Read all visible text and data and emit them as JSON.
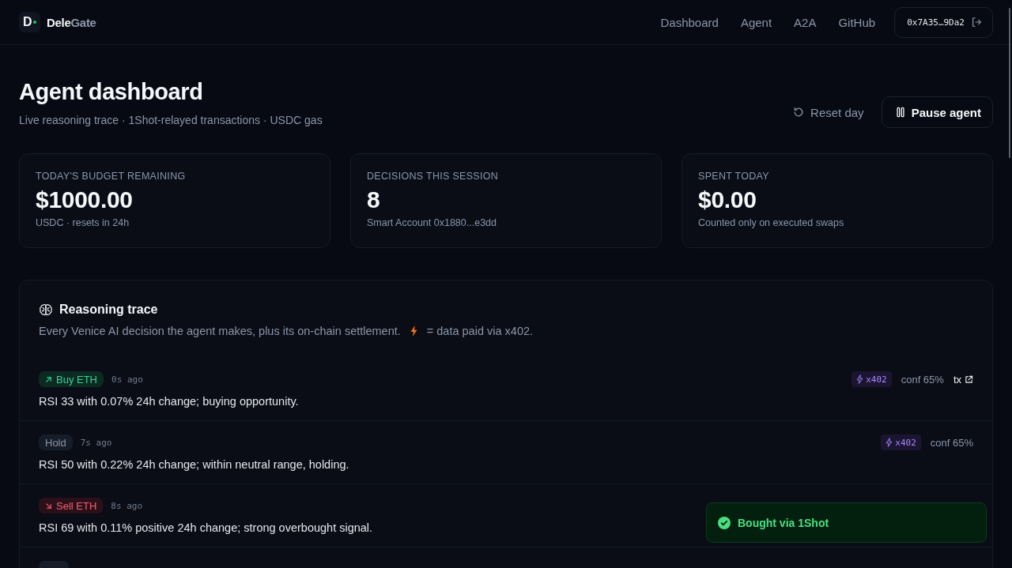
{
  "header": {
    "logo_mark": "D",
    "brand_parts": [
      {
        "text": "Dele",
        "kind": "strong"
      },
      {
        "text": "Gate",
        "kind": "muted"
      }
    ],
    "nav": [
      {
        "label": "Dashboard"
      },
      {
        "label": "Agent"
      },
      {
        "label": "A2A"
      },
      {
        "label": "GitHub"
      }
    ],
    "wallet": {
      "address": "0x7A35…9Da2"
    }
  },
  "page": {
    "title": "Agent dashboard",
    "subtitle": "Live reasoning trace · 1Shot-relayed transactions · USDC gas",
    "actions": [
      {
        "label": "Reset day",
        "kind": "ghost"
      },
      {
        "label": "Pause agent",
        "kind": "outline"
      }
    ]
  },
  "stats": [
    {
      "label": "TODAY'S BUDGET REMAINING",
      "value": "$1000.00",
      "note": "USDC · resets in 24h"
    },
    {
      "label": "DECISIONS THIS SESSION",
      "value": "8",
      "note": "Smart Account 0x1880...e3dd"
    },
    {
      "label": "SPENT TODAY",
      "value": "$0.00",
      "note": "Counted only on executed swaps"
    }
  ],
  "trace": {
    "title": "Reasoning trace",
    "description": "Every Venice AI decision the agent makes, plus its on-chain settlement.",
    "legend": "= data paid via x402.",
    "entries": [
      {
        "kind": "buy",
        "action": "Buy ETH",
        "time": "0s ago",
        "reasoning": "RSI 33 with 0.07% 24h change; buying opportunity.",
        "x402": "x402",
        "confidence": "conf 65%",
        "tx": "tx"
      },
      {
        "kind": "hold",
        "action": "Hold",
        "time": "7s ago",
        "reasoning": "RSI 50 with 0.22% 24h change; within neutral range, holding.",
        "x402": "x402",
        "confidence": "conf 65%"
      },
      {
        "kind": "sell",
        "action": "Sell ETH",
        "time": "8s ago",
        "reasoning": "RSI 69 with 0.11% positive 24h change; strong overbought signal."
      },
      {
        "kind": "hold"
      }
    ]
  },
  "toast": {
    "kind": "success",
    "message": "Bought via 1Shot"
  }
}
